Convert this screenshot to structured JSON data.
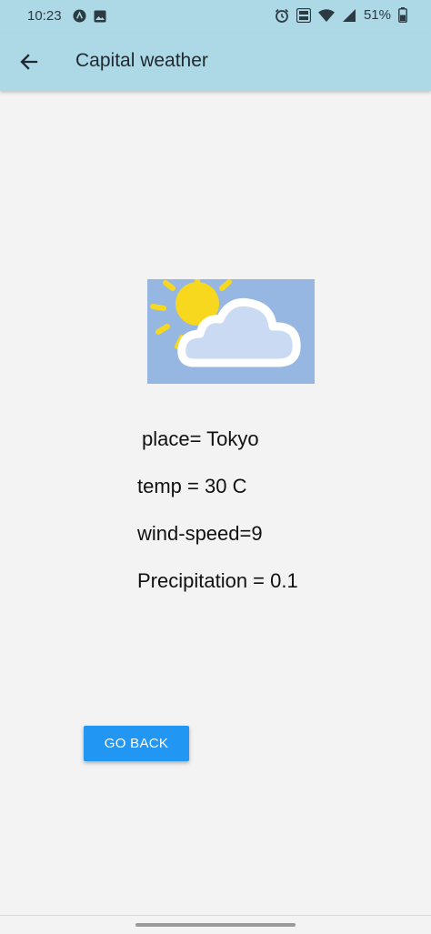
{
  "status_bar": {
    "time": "10:23",
    "battery_text": "51%",
    "left_icons": [
      "app-notification-icon",
      "image-notification-icon"
    ],
    "right_icons": [
      "alarm-icon",
      "volte-icon",
      "wifi-icon",
      "signal-icon",
      "battery-icon"
    ]
  },
  "app_bar": {
    "title": "Capital weather"
  },
  "weather": {
    "image_icon": "partly-cloudy-icon",
    "place": "place= Tokyo",
    "temp": "temp = 30 C",
    "wind_speed": "wind-speed=9",
    "precipitation": "Precipitation = 0.1"
  },
  "go_back_button": {
    "label": "GO BACK"
  },
  "colors": {
    "app_bar": "#add8e6",
    "background": "#f3f3f3",
    "button": "#2196f3",
    "image_bg": "#97b7e3",
    "sun": "#f7d81e"
  }
}
